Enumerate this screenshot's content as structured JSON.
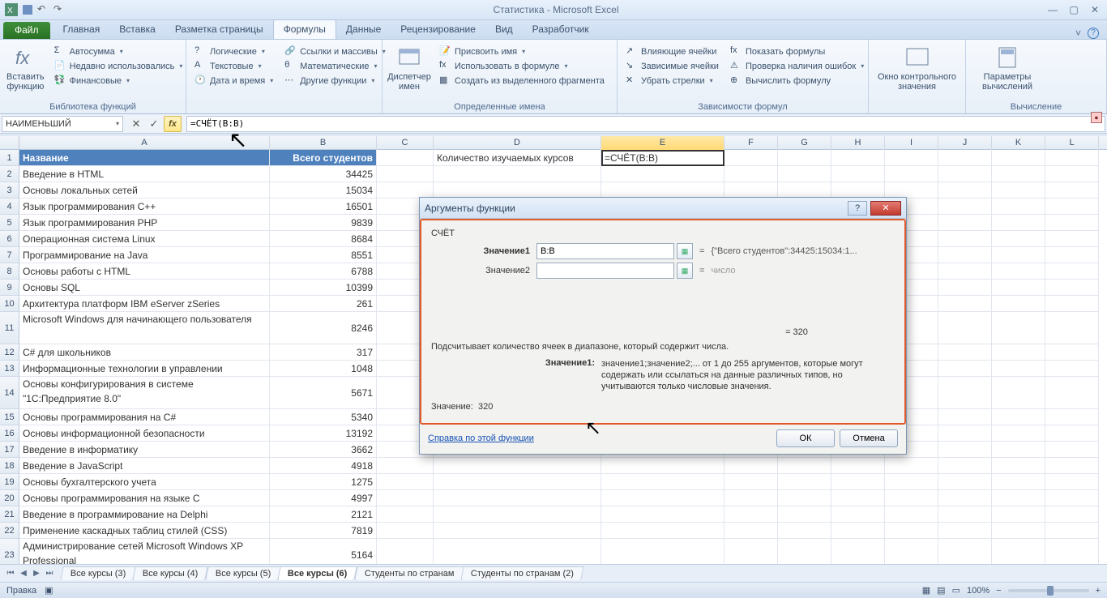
{
  "title": "Статистика - Microsoft Excel",
  "tabs": {
    "file": "Файл",
    "items": [
      "Главная",
      "Вставка",
      "Разметка страницы",
      "Формулы",
      "Данные",
      "Рецензирование",
      "Вид",
      "Разработчик"
    ],
    "active": 3
  },
  "ribbon": {
    "g1": {
      "big": "Вставить\nфункцию",
      "label": "",
      "items": [
        "Автосумма",
        "Недавно использовались",
        "Финансовые"
      ]
    },
    "g2": {
      "label": "Библиотека функций",
      "col1": [
        "Логические",
        "Текстовые",
        "Дата и время"
      ],
      "col2": [
        "Ссылки и массивы",
        "Математические",
        "Другие функции"
      ]
    },
    "g3": {
      "big": "Диспетчер\nимен",
      "label": "Определенные имена",
      "items": [
        "Присвоить имя",
        "Использовать в формуле",
        "Создать из выделенного фрагмента"
      ]
    },
    "g4": {
      "label": "Зависимости формул",
      "col1": [
        "Влияющие ячейки",
        "Зависимые ячейки",
        "Убрать стрелки"
      ],
      "col2": [
        "Показать формулы",
        "Проверка наличия ошибок",
        "Вычислить формулу"
      ]
    },
    "g5": {
      "big": "Окно контрольного\nзначения"
    },
    "g6": {
      "big": "Параметры\nвычислений",
      "label": "Вычисление"
    }
  },
  "namebox": "НАИМЕНЬШИЙ",
  "formula": "=СЧЁТ(B:B)",
  "columns": [
    "A",
    "B",
    "C",
    "D",
    "E",
    "F",
    "G",
    "H",
    "I",
    "J",
    "K",
    "L"
  ],
  "headerRow": {
    "A": "Название",
    "B": "Всего студентов"
  },
  "d1": "Количество изучаемых курсов",
  "e1": "=СЧЁТ(B:B)",
  "dataRows": [
    {
      "n": 2,
      "a": "Введение в HTML",
      "b": "34425"
    },
    {
      "n": 3,
      "a": "Основы локальных сетей",
      "b": "15034"
    },
    {
      "n": 4,
      "a": "Язык программирования C++",
      "b": "16501"
    },
    {
      "n": 5,
      "a": "Язык программирования PHP",
      "b": "9839"
    },
    {
      "n": 6,
      "a": "Операционная система Linux",
      "b": "8684"
    },
    {
      "n": 7,
      "a": "Программирование на Java",
      "b": "8551"
    },
    {
      "n": 8,
      "a": "Основы работы с HTML",
      "b": "6788"
    },
    {
      "n": 9,
      "a": "Основы SQL",
      "b": "10399"
    },
    {
      "n": 10,
      "a": "Архитектура платформ IBM eServer zSeries",
      "b": "261"
    },
    {
      "n": 11,
      "a": "Microsoft Windows для начинающего пользователя",
      "b": "8246"
    },
    {
      "n": 12,
      "a": "C# для школьников",
      "b": "317"
    },
    {
      "n": 13,
      "a": "Информационные технологии в управлении",
      "b": "1048"
    },
    {
      "n": 14,
      "a": "Основы конфигурирования в системе \"1С:Предприятие 8.0\"",
      "b": "5671"
    },
    {
      "n": 15,
      "a": "Основы программирования на C#",
      "b": "5340"
    },
    {
      "n": 16,
      "a": "Основы информационной безопасности",
      "b": "13192"
    },
    {
      "n": 17,
      "a": "Введение в информатику",
      "b": "3662"
    },
    {
      "n": 18,
      "a": "Введение в JavaScript",
      "b": "4918"
    },
    {
      "n": 19,
      "a": "Основы бухгалтерского учета",
      "b": "1275"
    },
    {
      "n": 20,
      "a": "Основы программирования на языке C",
      "b": "4997"
    },
    {
      "n": 21,
      "a": "Введение в программирование на Delphi",
      "b": "2121"
    },
    {
      "n": 22,
      "a": "Применение каскадных таблиц стилей (CSS)",
      "b": "7819"
    },
    {
      "n": 23,
      "a": "Администрирование сетей Microsoft Windows XP Professional",
      "b": "5164"
    }
  ],
  "sheetTabs": [
    "Все курсы (3)",
    "Все курсы (4)",
    "Все курсы (5)",
    "Все курсы (6)",
    "Студенты по странам",
    "Студенты по странам (2)"
  ],
  "sheetActive": 3,
  "dialog": {
    "title": "Аргументы функции",
    "func": "СЧЁТ",
    "arg1label": "Значение1",
    "arg1val": "B:B",
    "arg1preview": "{\"Всего студентов\":34425:15034:1...",
    "arg2label": "Значение2",
    "arg2preview": "число",
    "result": "= 320",
    "desc": "Подсчитывает количество ячеек в диапазоне, который содержит числа.",
    "argdescK": "Значение1:",
    "argdescV": "значение1;значение2;... от 1 до 255 аргументов, которые могут содержать или ссылаться на данные различных типов, но учитываются только числовые значения.",
    "valueLabel": "Значение:",
    "valueNum": "320",
    "help": "Справка по этой функции",
    "ok": "ОК",
    "cancel": "Отмена"
  },
  "status": {
    "left": "Правка",
    "zoom": "100%"
  }
}
